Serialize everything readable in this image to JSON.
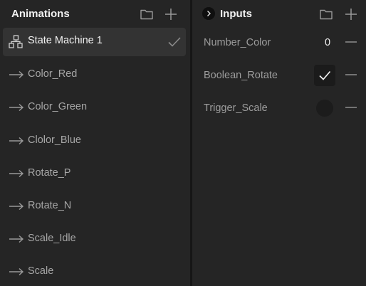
{
  "animations_panel": {
    "title": "Animations",
    "folder_icon": "folder-icon",
    "add_icon": "plus-icon",
    "selected": {
      "label": "State Machine 1",
      "icon": "state-machine-icon",
      "check_icon": "check-icon"
    },
    "items": [
      {
        "label": "Color_Red",
        "icon": "arrow-right-icon"
      },
      {
        "label": "Color_Green",
        "icon": "arrow-right-icon"
      },
      {
        "label": "Clolor_Blue",
        "icon": "arrow-right-icon"
      },
      {
        "label": "Rotate_P",
        "icon": "arrow-right-icon"
      },
      {
        "label": "Rotate_N",
        "icon": "arrow-right-icon"
      },
      {
        "label": "Scale_Idle",
        "icon": "arrow-right-icon"
      },
      {
        "label": "Scale",
        "icon": "arrow-right-icon"
      }
    ]
  },
  "inputs_panel": {
    "title": "Inputs",
    "expand_icon": "chevron-right-icon",
    "folder_icon": "folder-icon",
    "add_icon": "plus-icon",
    "inputs": [
      {
        "label": "Number_Color",
        "type": "number",
        "value": "0"
      },
      {
        "label": "Boolean_Rotate",
        "type": "boolean",
        "checked": true
      },
      {
        "label": "Trigger_Scale",
        "type": "trigger"
      }
    ],
    "remove_icon": "minus-icon"
  },
  "colors": {
    "background": "#252525",
    "selected_row": "#333333",
    "divider": "#161616",
    "text_primary": "#f2f2f2",
    "text_secondary": "#9d9d9d"
  }
}
